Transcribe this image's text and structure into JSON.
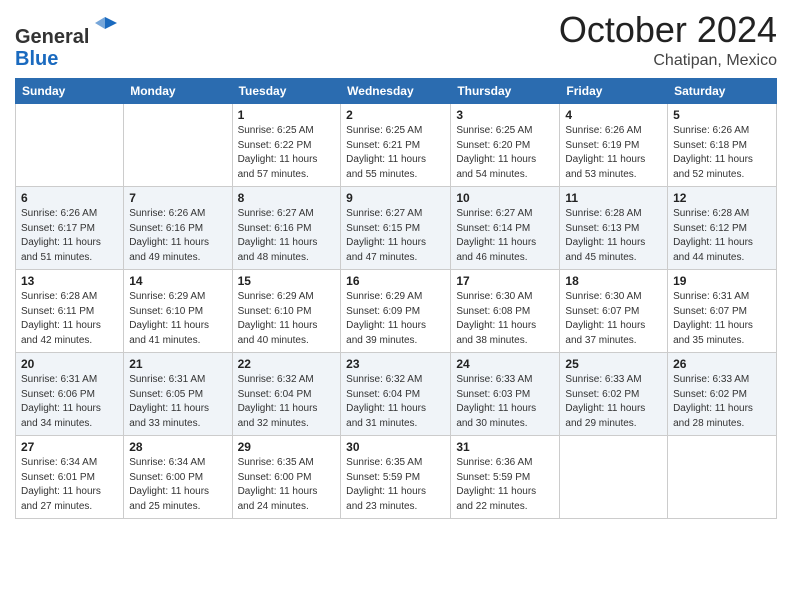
{
  "logo": {
    "general": "General",
    "blue": "Blue"
  },
  "header": {
    "month": "October 2024",
    "location": "Chatipan, Mexico"
  },
  "weekdays": [
    "Sunday",
    "Monday",
    "Tuesday",
    "Wednesday",
    "Thursday",
    "Friday",
    "Saturday"
  ],
  "weeks": [
    [
      {
        "day": "",
        "info": ""
      },
      {
        "day": "",
        "info": ""
      },
      {
        "day": "1",
        "info": "Sunrise: 6:25 AM\nSunset: 6:22 PM\nDaylight: 11 hours and 57 minutes."
      },
      {
        "day": "2",
        "info": "Sunrise: 6:25 AM\nSunset: 6:21 PM\nDaylight: 11 hours and 55 minutes."
      },
      {
        "day": "3",
        "info": "Sunrise: 6:25 AM\nSunset: 6:20 PM\nDaylight: 11 hours and 54 minutes."
      },
      {
        "day": "4",
        "info": "Sunrise: 6:26 AM\nSunset: 6:19 PM\nDaylight: 11 hours and 53 minutes."
      },
      {
        "day": "5",
        "info": "Sunrise: 6:26 AM\nSunset: 6:18 PM\nDaylight: 11 hours and 52 minutes."
      }
    ],
    [
      {
        "day": "6",
        "info": "Sunrise: 6:26 AM\nSunset: 6:17 PM\nDaylight: 11 hours and 51 minutes."
      },
      {
        "day": "7",
        "info": "Sunrise: 6:26 AM\nSunset: 6:16 PM\nDaylight: 11 hours and 49 minutes."
      },
      {
        "day": "8",
        "info": "Sunrise: 6:27 AM\nSunset: 6:16 PM\nDaylight: 11 hours and 48 minutes."
      },
      {
        "day": "9",
        "info": "Sunrise: 6:27 AM\nSunset: 6:15 PM\nDaylight: 11 hours and 47 minutes."
      },
      {
        "day": "10",
        "info": "Sunrise: 6:27 AM\nSunset: 6:14 PM\nDaylight: 11 hours and 46 minutes."
      },
      {
        "day": "11",
        "info": "Sunrise: 6:28 AM\nSunset: 6:13 PM\nDaylight: 11 hours and 45 minutes."
      },
      {
        "day": "12",
        "info": "Sunrise: 6:28 AM\nSunset: 6:12 PM\nDaylight: 11 hours and 44 minutes."
      }
    ],
    [
      {
        "day": "13",
        "info": "Sunrise: 6:28 AM\nSunset: 6:11 PM\nDaylight: 11 hours and 42 minutes."
      },
      {
        "day": "14",
        "info": "Sunrise: 6:29 AM\nSunset: 6:10 PM\nDaylight: 11 hours and 41 minutes."
      },
      {
        "day": "15",
        "info": "Sunrise: 6:29 AM\nSunset: 6:10 PM\nDaylight: 11 hours and 40 minutes."
      },
      {
        "day": "16",
        "info": "Sunrise: 6:29 AM\nSunset: 6:09 PM\nDaylight: 11 hours and 39 minutes."
      },
      {
        "day": "17",
        "info": "Sunrise: 6:30 AM\nSunset: 6:08 PM\nDaylight: 11 hours and 38 minutes."
      },
      {
        "day": "18",
        "info": "Sunrise: 6:30 AM\nSunset: 6:07 PM\nDaylight: 11 hours and 37 minutes."
      },
      {
        "day": "19",
        "info": "Sunrise: 6:31 AM\nSunset: 6:07 PM\nDaylight: 11 hours and 35 minutes."
      }
    ],
    [
      {
        "day": "20",
        "info": "Sunrise: 6:31 AM\nSunset: 6:06 PM\nDaylight: 11 hours and 34 minutes."
      },
      {
        "day": "21",
        "info": "Sunrise: 6:31 AM\nSunset: 6:05 PM\nDaylight: 11 hours and 33 minutes."
      },
      {
        "day": "22",
        "info": "Sunrise: 6:32 AM\nSunset: 6:04 PM\nDaylight: 11 hours and 32 minutes."
      },
      {
        "day": "23",
        "info": "Sunrise: 6:32 AM\nSunset: 6:04 PM\nDaylight: 11 hours and 31 minutes."
      },
      {
        "day": "24",
        "info": "Sunrise: 6:33 AM\nSunset: 6:03 PM\nDaylight: 11 hours and 30 minutes."
      },
      {
        "day": "25",
        "info": "Sunrise: 6:33 AM\nSunset: 6:02 PM\nDaylight: 11 hours and 29 minutes."
      },
      {
        "day": "26",
        "info": "Sunrise: 6:33 AM\nSunset: 6:02 PM\nDaylight: 11 hours and 28 minutes."
      }
    ],
    [
      {
        "day": "27",
        "info": "Sunrise: 6:34 AM\nSunset: 6:01 PM\nDaylight: 11 hours and 27 minutes."
      },
      {
        "day": "28",
        "info": "Sunrise: 6:34 AM\nSunset: 6:00 PM\nDaylight: 11 hours and 25 minutes."
      },
      {
        "day": "29",
        "info": "Sunrise: 6:35 AM\nSunset: 6:00 PM\nDaylight: 11 hours and 24 minutes."
      },
      {
        "day": "30",
        "info": "Sunrise: 6:35 AM\nSunset: 5:59 PM\nDaylight: 11 hours and 23 minutes."
      },
      {
        "day": "31",
        "info": "Sunrise: 6:36 AM\nSunset: 5:59 PM\nDaylight: 11 hours and 22 minutes."
      },
      {
        "day": "",
        "info": ""
      },
      {
        "day": "",
        "info": ""
      }
    ]
  ]
}
